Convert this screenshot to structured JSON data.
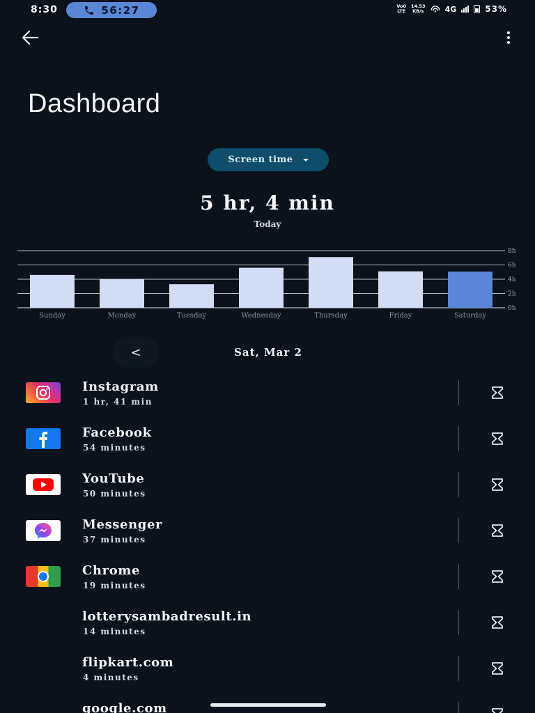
{
  "status_bar": {
    "time": "8:30",
    "call_timer": "56:27",
    "volte_top": "Vo0",
    "volte_bottom": "LTE",
    "speed_top": "14.53",
    "speed_bottom": "KB/s",
    "network": "4G",
    "battery": "53%"
  },
  "header": {
    "title": "Dashboard"
  },
  "selector": {
    "label": "Screen time"
  },
  "summary": {
    "total": "5 hr, 4 min",
    "period": "Today"
  },
  "chart_data": {
    "type": "bar",
    "categories": [
      "Sunday",
      "Monday",
      "Tuesday",
      "Wednesday",
      "Thursday",
      "Friday",
      "Saturday"
    ],
    "values": [
      4.6,
      4.0,
      3.3,
      5.6,
      7.1,
      5.1,
      5.07
    ],
    "y_ticks": [
      "0h",
      "2h",
      "4h",
      "6h",
      "8h"
    ],
    "ylim": [
      0,
      8
    ],
    "unit": "h",
    "highlight_index": 6,
    "bar_color": "#d2dcf4",
    "highlight_color": "#5b86d6",
    "grid": true
  },
  "date_nav": {
    "prev_label": "<",
    "date": "Sat, Mar 2"
  },
  "apps": [
    {
      "name": "Instagram",
      "usage": "1 hr, 41 min",
      "icon": "instagram-icon"
    },
    {
      "name": "Facebook",
      "usage": "54 minutes",
      "icon": "facebook-icon"
    },
    {
      "name": "YouTube",
      "usage": "50 minutes",
      "icon": "youtube-icon"
    },
    {
      "name": "Messenger",
      "usage": "37 minutes",
      "icon": "messenger-icon"
    },
    {
      "name": "Chrome",
      "usage": "19 minutes",
      "icon": "chrome-icon"
    },
    {
      "name": "lotterysambadresult.in",
      "usage": "14 minutes",
      "icon": ""
    },
    {
      "name": "flipkart.com",
      "usage": "4 minutes",
      "icon": ""
    },
    {
      "name": "google.com",
      "usage": "",
      "icon": ""
    }
  ]
}
